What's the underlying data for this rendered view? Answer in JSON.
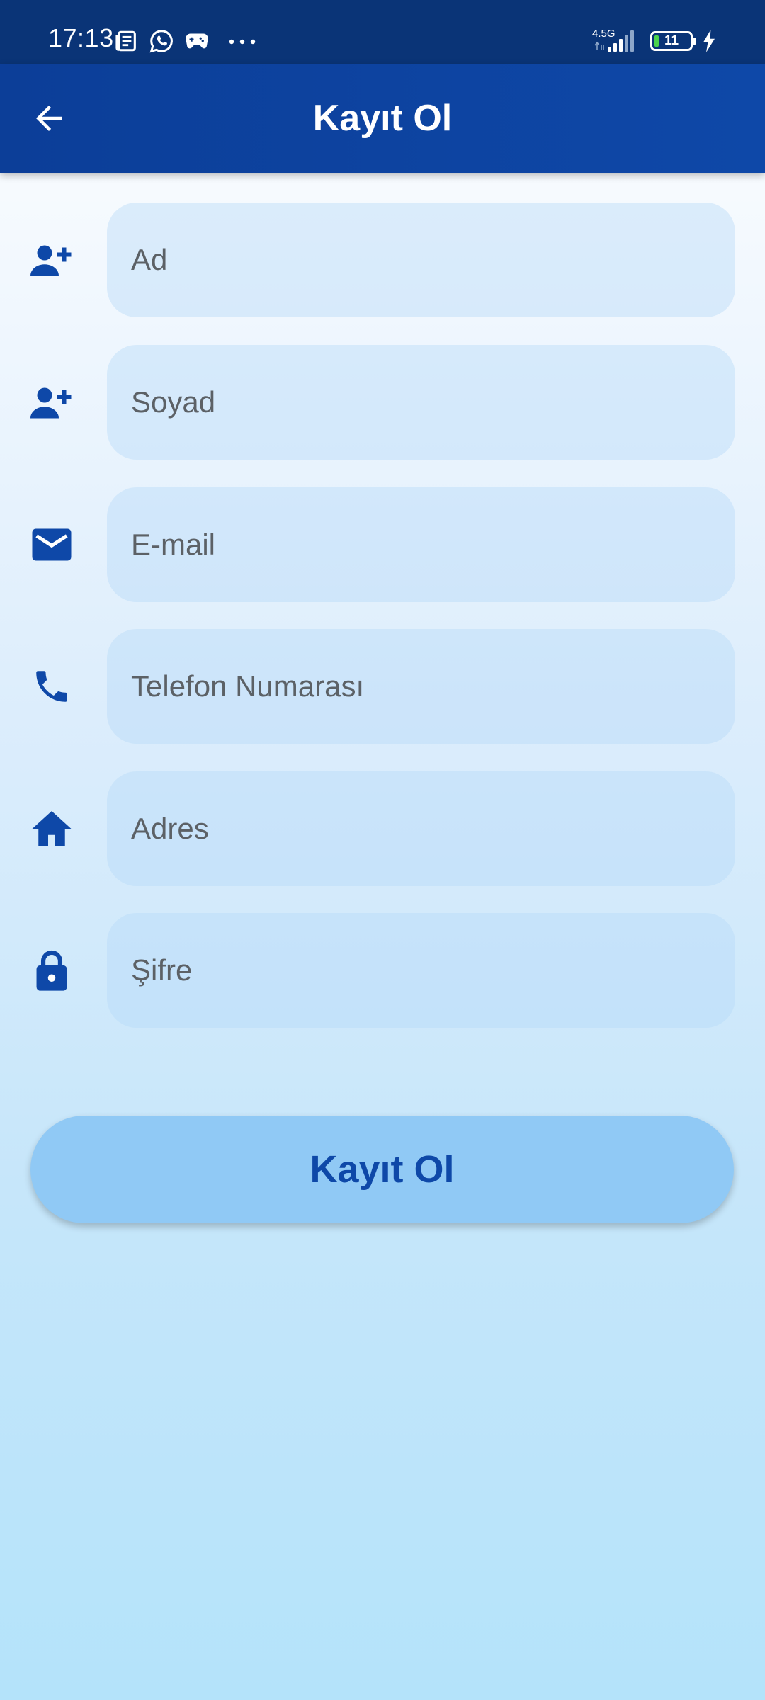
{
  "status_bar": {
    "time": "17:13",
    "network": "4.5G",
    "battery": "11",
    "icons": [
      "news-icon",
      "whatsapp-icon",
      "game-controller-icon",
      "more-dots-icon",
      "signal-icon",
      "battery-icon",
      "charging-icon"
    ]
  },
  "app_bar": {
    "title": "Kayıt Ol",
    "back_icon": "arrow-back-icon"
  },
  "form": {
    "fields": [
      {
        "icon": "person-add-icon",
        "placeholder": "Ad",
        "value": ""
      },
      {
        "icon": "person-add-icon",
        "placeholder": "Soyad",
        "value": ""
      },
      {
        "icon": "email-icon",
        "placeholder": "E-mail",
        "value": ""
      },
      {
        "icon": "phone-icon",
        "placeholder": "Telefon Numarası",
        "value": ""
      },
      {
        "icon": "home-icon",
        "placeholder": "Adres",
        "value": ""
      },
      {
        "icon": "lock-icon",
        "placeholder": "Şifre",
        "value": ""
      }
    ],
    "submit_label": "Kayıt Ol"
  },
  "colors": {
    "status_bar": "#0a3477",
    "app_bar": "#0e48a8",
    "accent": "#0e48a8",
    "button_bg": "#90c9f5",
    "field_bg": "#d6ebfb"
  }
}
